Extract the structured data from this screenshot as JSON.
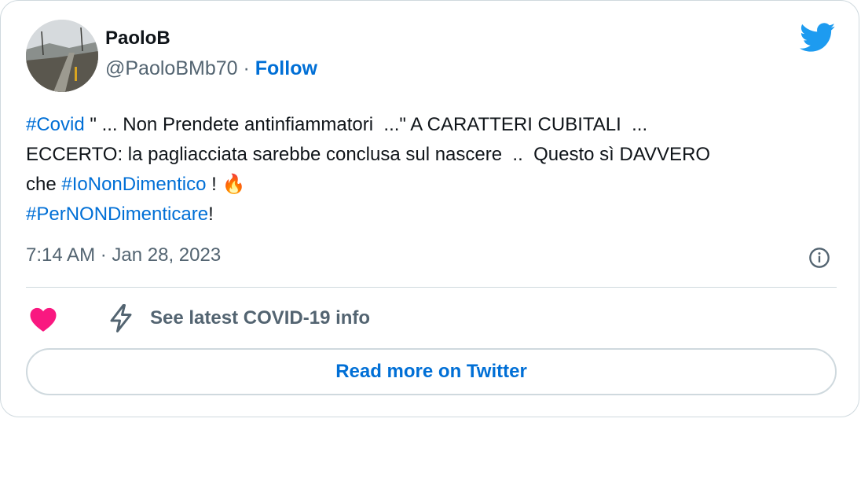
{
  "author": {
    "name": "PaoloB",
    "handle": "@PaoloBMb70",
    "separator": "·",
    "follow_label": "Follow"
  },
  "tweet": {
    "line1": [
      {
        "text": "#Covid",
        "tag": true
      },
      {
        "text": " \" ... Non Prendete antinfiammatori  ...\" A CARATTERI CUBITALI  ...",
        "tag": false
      }
    ],
    "line2": "ECCERTO: la pagliacciata sarebbe conclusa sul nascere  ..  Questo sì DAVVERO",
    "line3_pre": "che ",
    "line3_tag": "#IoNonDimentico",
    "line3_post": " ! ",
    "emoji": "🔥",
    "line4_tag": "#PerNONDimenticare",
    "line4_post": "!"
  },
  "timestamp": "7:14 AM · Jan 28, 2023",
  "actions": {
    "covid_info_label": "See latest COVID-19 info"
  },
  "read_more_label": "Read more on Twitter",
  "colors": {
    "link": "#006fd6",
    "heart": "#f91880",
    "twitter_blue": "#1d9bf0",
    "muted": "#536471"
  },
  "icons": [
    "twitter-bird-icon",
    "info-icon",
    "heart-icon",
    "lightning-bolt-icon"
  ]
}
